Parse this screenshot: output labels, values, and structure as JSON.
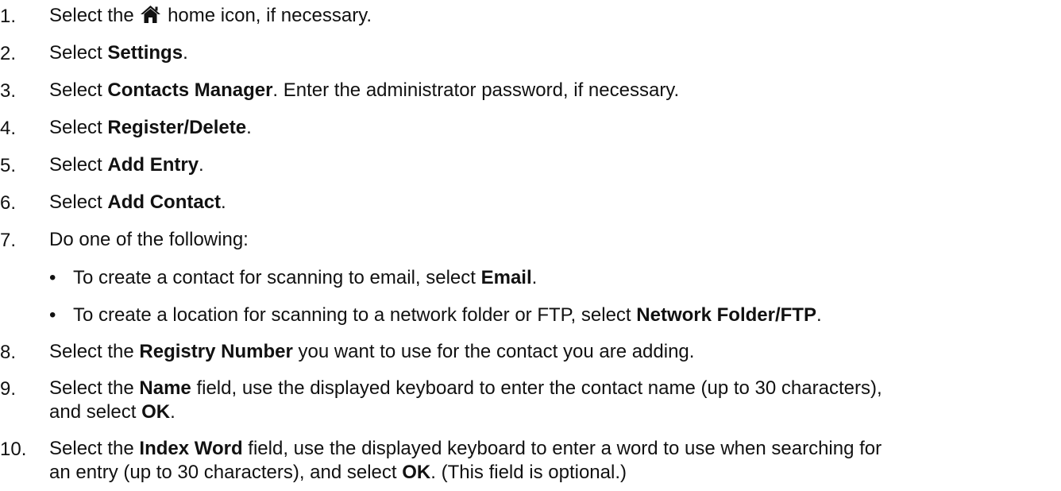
{
  "steps": [
    {
      "num": "1.",
      "parts": [
        {
          "t": "Select the "
        },
        {
          "icon": "home-icon"
        },
        {
          "t": " home icon, if necessary."
        }
      ]
    },
    {
      "num": "2.",
      "parts": [
        {
          "t": "Select "
        },
        {
          "b": "Settings"
        },
        {
          "t": "."
        }
      ]
    },
    {
      "num": "3.",
      "parts": [
        {
          "t": "Select "
        },
        {
          "b": "Contacts Manager"
        },
        {
          "t": ". Enter the administrator password, if necessary."
        }
      ]
    },
    {
      "num": "4.",
      "parts": [
        {
          "t": "Select "
        },
        {
          "b": "Register/Delete"
        },
        {
          "t": "."
        }
      ]
    },
    {
      "num": "5.",
      "parts": [
        {
          "t": "Select "
        },
        {
          "b": "Add Entry"
        },
        {
          "t": "."
        }
      ]
    },
    {
      "num": "6.",
      "parts": [
        {
          "t": "Select "
        },
        {
          "b": "Add Contact"
        },
        {
          "t": "."
        }
      ]
    },
    {
      "num": "7.",
      "parts": [
        {
          "t": "Do one of the following:"
        }
      ],
      "bullets": [
        {
          "dot": "•",
          "parts": [
            {
              "t": "To create a contact for scanning to email, select "
            },
            {
              "b": "Email"
            },
            {
              "t": "."
            }
          ]
        },
        {
          "dot": "•",
          "parts": [
            {
              "t": "To create a location for scanning to a network folder or FTP, select "
            },
            {
              "b": "Network Folder/FTP"
            },
            {
              "t": "."
            }
          ]
        }
      ]
    },
    {
      "num": "8.",
      "parts": [
        {
          "t": "Select the "
        },
        {
          "b": "Registry Number"
        },
        {
          "t": " you want to use for the contact you are adding."
        }
      ]
    },
    {
      "num": "9.",
      "parts": [
        {
          "t": "Select the "
        },
        {
          "b": "Name"
        },
        {
          "t": " field, use the displayed keyboard to enter the contact name (up to 30 characters),"
        },
        {
          "br": true
        },
        {
          "t": "and select "
        },
        {
          "b": "OK"
        },
        {
          "t": "."
        }
      ]
    },
    {
      "num": "10.",
      "parts": [
        {
          "t": "Select the "
        },
        {
          "b": "Index Word"
        },
        {
          "t": " field, use the displayed keyboard to enter a word to use when searching for"
        },
        {
          "br": true
        },
        {
          "t": "an entry (up to 30 characters), and select "
        },
        {
          "b": "OK"
        },
        {
          "t": ". (This field is optional.)"
        }
      ]
    }
  ]
}
